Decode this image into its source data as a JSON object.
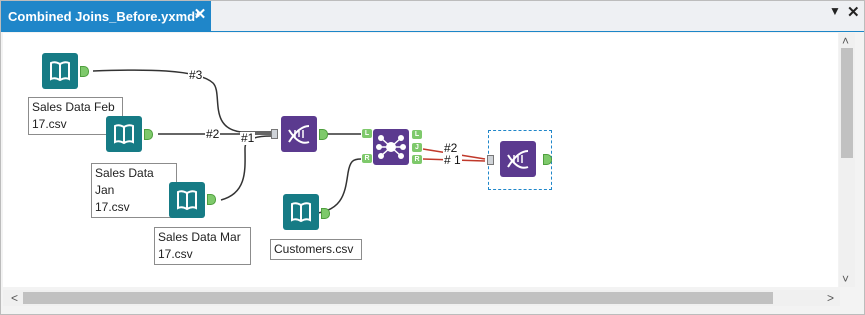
{
  "tab": {
    "title": "Combined Joins_Before.yxmd*",
    "close_glyph": "✕"
  },
  "window": {
    "menu_glyph": "▼",
    "close_glyph": "✕"
  },
  "tools": {
    "input_feb": {
      "label_line1": "Sales Data Feb",
      "label_line2": "17.csv"
    },
    "input_jan": {
      "label_line1": "Sales Data Jan",
      "label_line2": "17.csv"
    },
    "input_mar": {
      "label_line1": "Sales Data Mar",
      "label_line2": "17.csv"
    },
    "input_customers": {
      "label": "Customers.csv"
    },
    "join": {
      "ports": {
        "left_in": "L",
        "right_in": "R",
        "out_left": "L",
        "out_join": "J",
        "out_right": "R"
      }
    }
  },
  "wire_labels": {
    "w3": "#3",
    "w2a": "#2",
    "w1": "#1",
    "w2b": "#2",
    "w1b": "# 1"
  },
  "scroll": {
    "up": "˄",
    "down": "˅",
    "left": "<",
    "right": ">"
  },
  "colors": {
    "accent": "#1f86c9",
    "input_tool": "#167b85",
    "union_tool": "#5b3a8f",
    "wire": "#444444",
    "error_wire": "#c0392b"
  }
}
